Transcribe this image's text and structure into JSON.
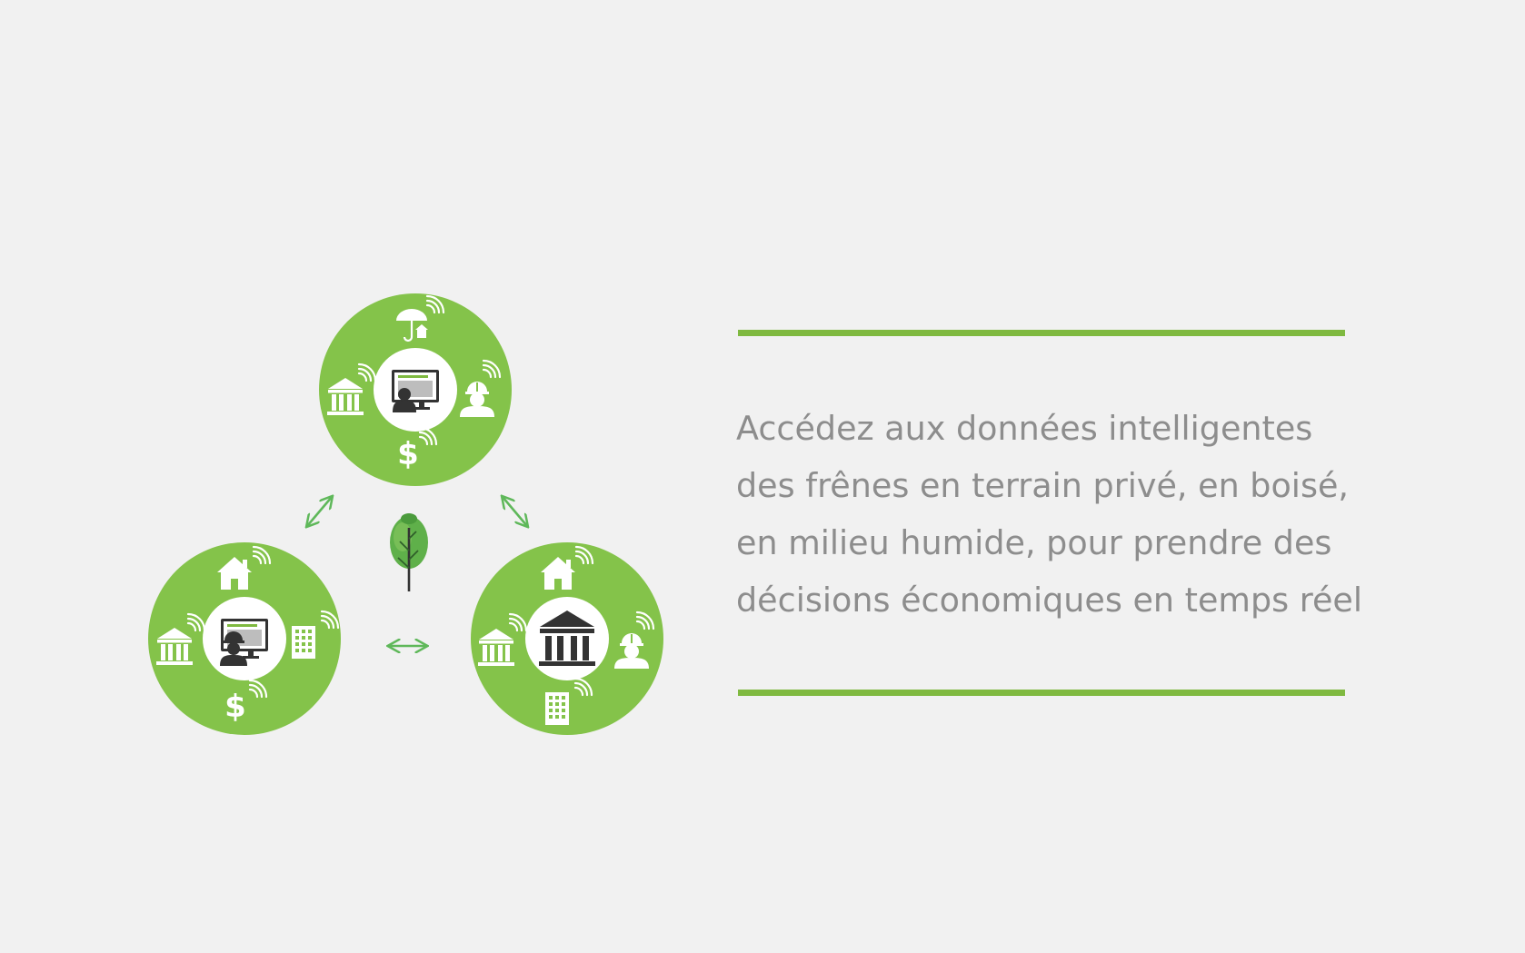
{
  "colors": {
    "background": "#f1f1f1",
    "accent_green": "#84c34a",
    "rule_green": "#7fb940",
    "arrow_green": "#5fb85a",
    "text_gray": "#8d8d8d",
    "icon_dark": "#3a3a3a",
    "tree_dark": "#2f7d32",
    "tree_light": "#5fb04a"
  },
  "tagline": {
    "lines": [
      "Accédez aux données intelligentes",
      "des frênes en terrain privé, en boisé,",
      "en milieu humide, pour prendre des",
      "décisions économiques en temps réel"
    ]
  },
  "diagram": {
    "top_node": {
      "center_icon": "user-at-monitor-icon",
      "ring_icons": [
        "umbrella-house-icon",
        "institution-icon",
        "worker-icon",
        "dollar-icon"
      ]
    },
    "left_node": {
      "center_icon": "worker-at-monitor-icon",
      "ring_icons": [
        "house-icon",
        "institution-icon",
        "office-building-icon",
        "dollar-icon"
      ]
    },
    "right_node": {
      "center_icon": "institution-icon",
      "ring_icons": [
        "house-icon",
        "institution-icon",
        "worker-icon",
        "office-building-icon"
      ]
    },
    "center_icon": "tree-icon",
    "connectors": [
      "diagonal-double-arrow-icon",
      "diagonal-double-arrow-icon",
      "horizontal-double-arrow-icon"
    ]
  }
}
